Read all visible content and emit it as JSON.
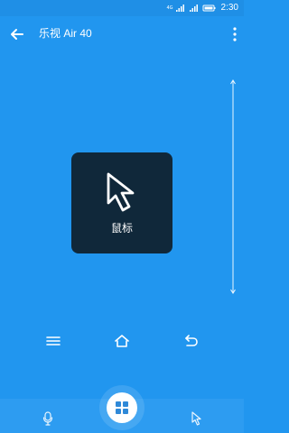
{
  "status_bar": {
    "network": "4G",
    "time": "2:30"
  },
  "header": {
    "title": "乐视 Air 40"
  },
  "main": {
    "mouse_label": "鼠标"
  },
  "colors": {
    "background": "#2196ef",
    "card": "#10283a",
    "icon": "#ffffff"
  },
  "icons": {
    "back": "back-arrow-icon",
    "more": "more-vertical-icon",
    "cursor": "cursor-icon",
    "menu": "menu-icon",
    "home": "home-icon",
    "return": "return-icon",
    "mic": "mic-icon",
    "keypad": "keypad-icon",
    "pointer": "pointer-icon"
  }
}
